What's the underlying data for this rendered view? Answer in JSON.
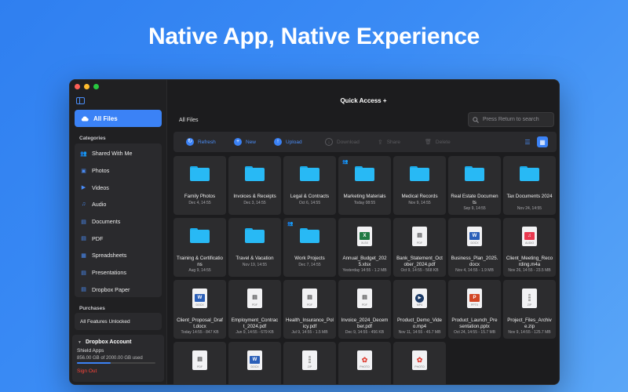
{
  "headline": "Native App, Native Experience",
  "window": {
    "title": "Quick Access +",
    "breadcrumb": "All Files"
  },
  "sidebar": {
    "all_files": "All Files",
    "categories_title": "Categories",
    "categories": [
      {
        "label": "Shared With Me",
        "icon": "people-icon"
      },
      {
        "label": "Photos",
        "icon": "photo-icon"
      },
      {
        "label": "Videos",
        "icon": "video-icon"
      },
      {
        "label": "Audio",
        "icon": "audio-icon"
      },
      {
        "label": "Documents",
        "icon": "document-icon"
      },
      {
        "label": "PDF",
        "icon": "pdf-icon"
      },
      {
        "label": "Spreadsheets",
        "icon": "spreadsheet-icon"
      },
      {
        "label": "Presentations",
        "icon": "presentation-icon"
      },
      {
        "label": "Dropbox Paper",
        "icon": "paper-icon"
      }
    ],
    "purchases_title": "Purchases",
    "purchase_item": "All Features Unlocked",
    "account": {
      "title": "Dropbox Account",
      "app": "Shield Apps",
      "usage": "856.00 GB of 2000.00 GB used",
      "usage_fraction": 0.428,
      "sign_out": "Sign Out"
    }
  },
  "search": {
    "placeholder": "Press Return to search"
  },
  "toolbar": {
    "refresh": "Refresh",
    "new": "New",
    "upload": "Upload",
    "download": "Download",
    "share": "Share",
    "delete": "Delete"
  },
  "files": [
    {
      "name": "Family Photos",
      "meta": "Dec 4, 14:55",
      "kind": "folder",
      "shared": false
    },
    {
      "name": "Invoices & Receipts",
      "meta": "Dec 3, 14:55",
      "kind": "folder",
      "shared": false
    },
    {
      "name": "Legal & Contracts",
      "meta": "Oct 6, 14:55",
      "kind": "folder",
      "shared": false
    },
    {
      "name": "Marketing Materials",
      "meta": "Today 08:55",
      "kind": "folder",
      "shared": true
    },
    {
      "name": "Medical Records",
      "meta": "Nov 9, 14:55",
      "kind": "folder",
      "shared": false
    },
    {
      "name": "Real Estate Documents",
      "meta": "Sep 9, 14:55",
      "kind": "folder",
      "shared": false
    },
    {
      "name": "Tax Documents 2024",
      "meta": "Nov 24, 14:55",
      "kind": "folder",
      "shared": false
    },
    {
      "name": "Training & Certifications",
      "meta": "Aug 9, 14:55",
      "kind": "folder",
      "shared": false
    },
    {
      "name": "Travel & Vacation",
      "meta": "Nov 19, 14:55",
      "kind": "folder",
      "shared": false
    },
    {
      "name": "Work Projects",
      "meta": "Dec 7, 14:55",
      "kind": "folder",
      "shared": true
    },
    {
      "name": "Annual_Budget_2025.xlsx",
      "meta": "Yesterday 14:55 - 1.2 MB",
      "kind": "xlsx",
      "shared": false
    },
    {
      "name": "Bank_Statement_October_2024.pdf",
      "meta": "Oct 9, 14:55 - 568 KB",
      "kind": "pdf",
      "shared": false
    },
    {
      "name": "Business_Plan_2025.docx",
      "meta": "Nov 4, 14:55 - 1.9 MB",
      "kind": "docx",
      "shared": false
    },
    {
      "name": "Client_Meeting_Recording.m4a",
      "meta": "Nov 26, 14:55 - 23.5 MB",
      "kind": "audio",
      "shared": false
    },
    {
      "name": "Client_Proposal_Draft.docx",
      "meta": "Today 14:55 - 847 KB",
      "kind": "docx",
      "shared": false
    },
    {
      "name": "Employment_Contract_2024.pdf",
      "meta": "Jun 9, 14:55 - 679 KB",
      "kind": "pdf",
      "shared": false
    },
    {
      "name": "Health_Insurance_Policy.pdf",
      "meta": "Jul 9, 14:55 - 1.5 MB",
      "kind": "pdf",
      "shared": false
    },
    {
      "name": "Invoice_2024_December.pdf",
      "meta": "Dec 9, 14:55 - 456 KB",
      "kind": "pdf",
      "shared": false
    },
    {
      "name": "Product_Demo_Video.mp4",
      "meta": "Nov 11, 14:55 - 45.7 MB",
      "kind": "video",
      "shared": false
    },
    {
      "name": "Product_Launch_Presentation.pptx",
      "meta": "Oct 24, 14:55 - 15.7 MB",
      "kind": "pptx",
      "shared": false
    },
    {
      "name": "Project_Files_Archive.zip",
      "meta": "Nov 9, 14:55 - 125.7 MB",
      "kind": "zip",
      "shared": false
    },
    {
      "name": "",
      "meta": "",
      "kind": "pdf",
      "shared": false
    },
    {
      "name": "",
      "meta": "",
      "kind": "docx",
      "shared": false
    },
    {
      "name": "",
      "meta": "",
      "kind": "zip",
      "shared": false
    },
    {
      "name": "",
      "meta": "",
      "kind": "photo",
      "shared": false
    },
    {
      "name": "",
      "meta": "",
      "kind": "photo",
      "shared": false
    }
  ],
  "colors": {
    "accent": "#3b82f6",
    "folder": "#28b9f5",
    "xlsx": "#1f7a43",
    "docx": "#2b5fb8",
    "pptx": "#d24625",
    "audio": "#e8384f",
    "sign_out": "#ff453a"
  }
}
